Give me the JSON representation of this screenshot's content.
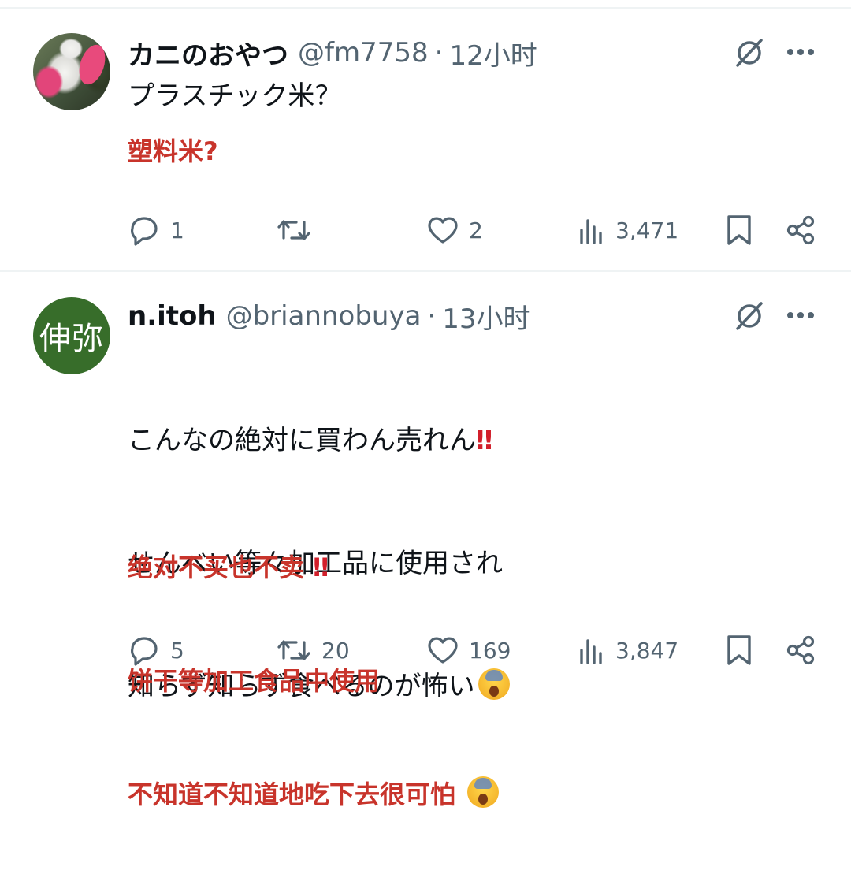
{
  "tweets": [
    {
      "user": {
        "name": "カニのおやつ",
        "handle": "@fm7758",
        "time": "12小时",
        "avatar_type": "photo"
      },
      "text": "プラスチック米？",
      "translation": "塑料米?",
      "stats": {
        "replies": "1",
        "reposts": "",
        "likes": "2",
        "views": "3,471"
      }
    },
    {
      "user": {
        "name": "n.itoh",
        "handle": "@briannobuya",
        "time": "13小时",
        "avatar_text": "伸弥"
      },
      "text_lines": [
        "こんなの絶対に買わん売れん",
        "せんべい等々加工品に使用され",
        "知らず知らず食べるのが怖い"
      ],
      "translation_lines": [
        "绝对不买也不卖 ",
        "饼干等加工食品中使用",
        "不知道不知道地吃下去很可怕 "
      ],
      "emoji": {
        "double_exclamation": "‼",
        "scream_face": "screaming-face-emoji"
      },
      "stats": {
        "replies": "5",
        "reposts": "20",
        "likes": "169",
        "views": "3,847"
      }
    }
  ],
  "icons": [
    "grok-icon",
    "more-icon",
    "reply-icon",
    "repost-icon",
    "like-icon",
    "views-icon",
    "bookmark-icon",
    "share-icon"
  ],
  "colors": {
    "translation": "#c8342b",
    "secondary": "#536471",
    "avatar_green": "#376d2a"
  }
}
